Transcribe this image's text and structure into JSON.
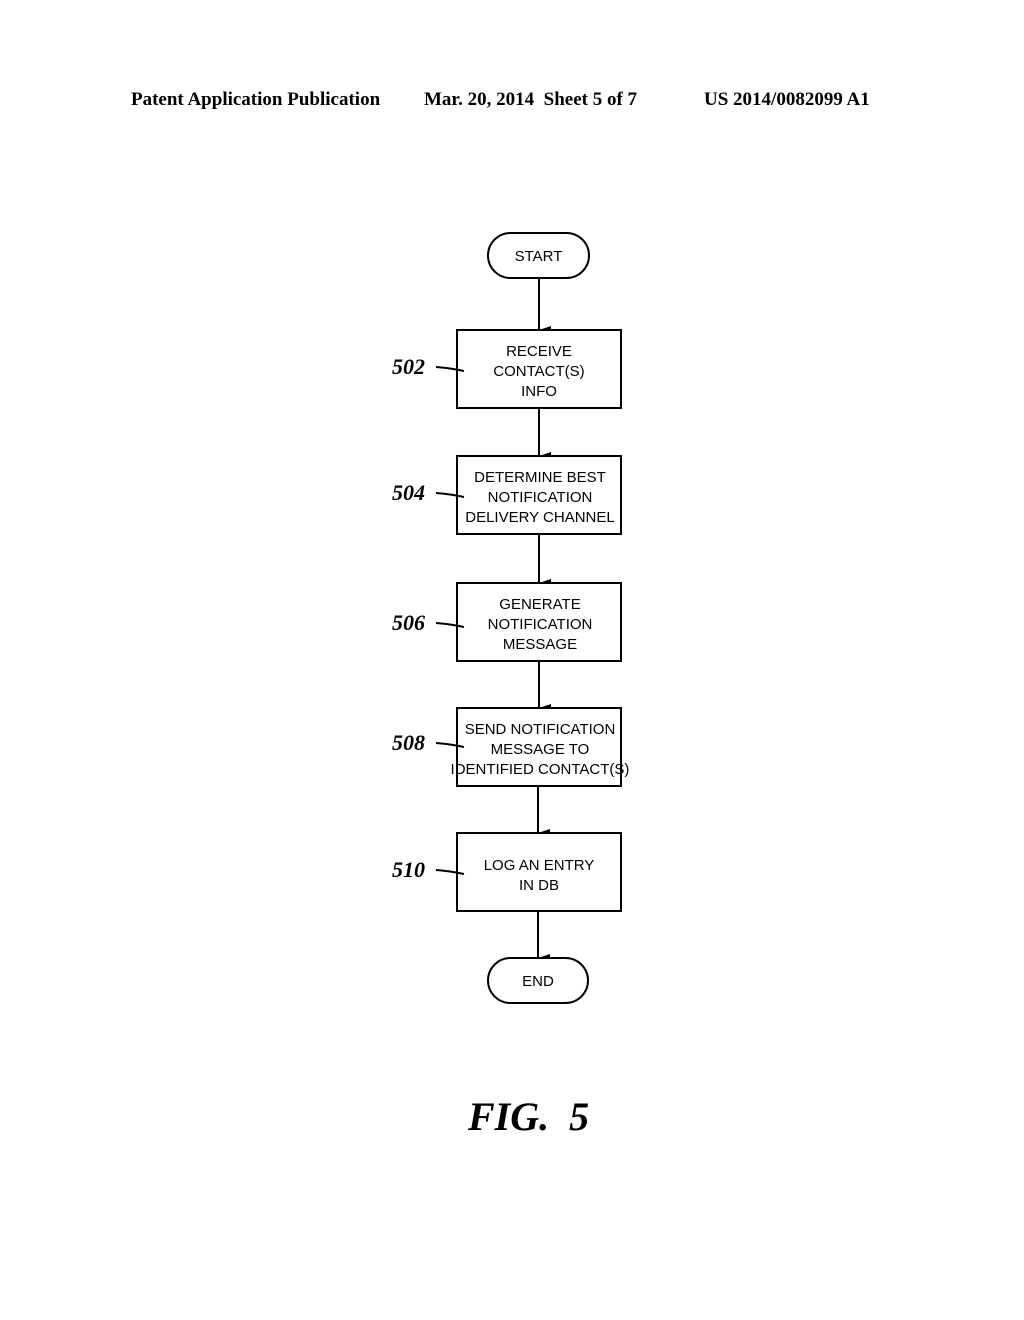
{
  "header": {
    "publication": "Patent Application Publication",
    "date_sheet": "Mar. 20, 2014  Sheet 5 of 7",
    "patent_number": "US 2014/0082099 A1"
  },
  "flowchart": {
    "start": "START",
    "end": "END",
    "steps": [
      {
        "ref": "502",
        "lines": [
          "RECEIVE",
          "CONTACT(S)",
          "INFO"
        ]
      },
      {
        "ref": "504",
        "lines": [
          "DETERMINE BEST",
          "NOTIFICATION",
          "DELIVERY CHANNEL"
        ]
      },
      {
        "ref": "506",
        "lines": [
          "GENERATE",
          "NOTIFICATION",
          "MESSAGE"
        ]
      },
      {
        "ref": "508",
        "lines": [
          "SEND NOTIFICATION",
          "MESSAGE TO",
          "IDENTIFIED CONTACT(S)"
        ]
      },
      {
        "ref": "510",
        "lines": [
          "LOG AN ENTRY",
          "IN DB"
        ]
      }
    ]
  },
  "figure_label": "FIG.  5"
}
